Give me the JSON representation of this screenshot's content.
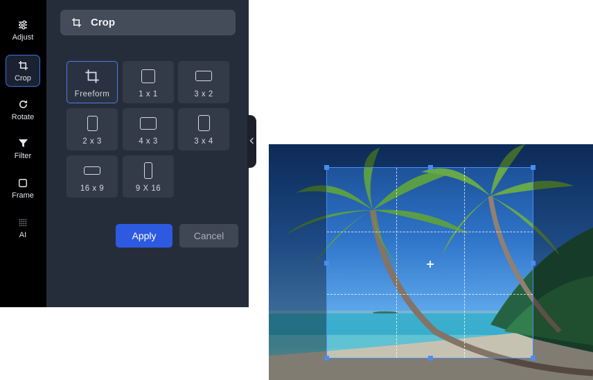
{
  "sidebar": {
    "items": [
      {
        "label": "Adjust",
        "icon": "sliders-icon"
      },
      {
        "label": "Crop",
        "icon": "crop-icon",
        "active": true
      },
      {
        "label": "Rotate",
        "icon": "rotate-icon"
      },
      {
        "label": "Filter",
        "icon": "filter-icon"
      },
      {
        "label": "Frame",
        "icon": "frame-icon"
      },
      {
        "label": "AI",
        "icon": "ai-dots-icon"
      }
    ]
  },
  "panel": {
    "title": "Crop",
    "title_icon": "crop-icon",
    "ratios": [
      {
        "label": "Freeform",
        "selected": true
      },
      {
        "label": "1 x 1"
      },
      {
        "label": "3 x 2"
      },
      {
        "label": "2 x 3"
      },
      {
        "label": "4 x 3"
      },
      {
        "label": "3 x 4"
      },
      {
        "label": "16 x 9"
      },
      {
        "label": "9 X 16"
      }
    ],
    "apply_label": "Apply",
    "cancel_label": "Cancel"
  },
  "colors": {
    "rail_bg": "#000000",
    "panel_bg": "#262d3a",
    "accent": "#2d5ae0",
    "crop_border": "#4a8cf0"
  }
}
